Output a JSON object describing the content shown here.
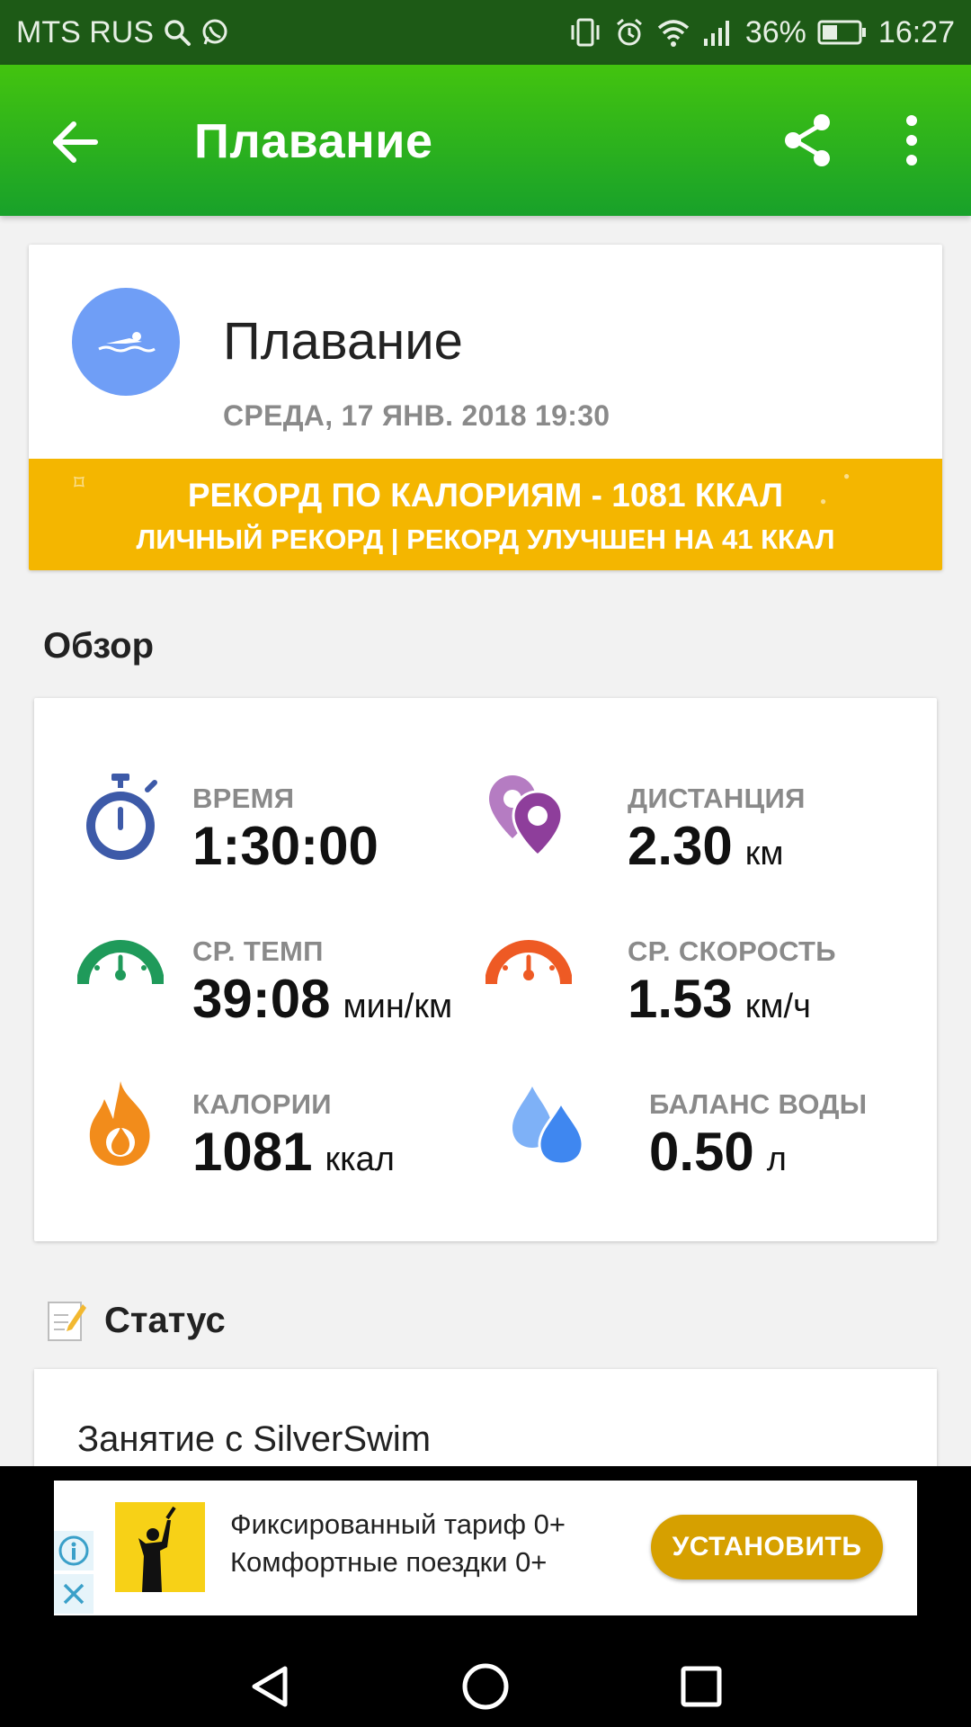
{
  "status_bar": {
    "carrier": "MTS RUS",
    "battery_percent": "36%",
    "time": "16:27",
    "icons": [
      "search-icon",
      "whatsapp-icon",
      "vibrate-icon",
      "alarm-icon",
      "wifi-icon",
      "signal-icon",
      "battery-icon"
    ]
  },
  "app_bar": {
    "title": "Плавание",
    "icons": [
      "back-arrow-icon",
      "share-icon",
      "more-vert-icon"
    ]
  },
  "activity": {
    "title": "Плавание",
    "date": "СРЕДА, 17 ЯНВ. 2018 19:30",
    "icon": "swimmer-icon",
    "avatar_color": "#6f9ef6"
  },
  "record": {
    "line1": "РЕКОРД ПО КАЛОРИЯМ  -  1081 ККАЛ",
    "line2": "ЛИЧНЫЙ РЕКОРД  |  РЕКОРД УЛУЧШЕН НА 41 ККАЛ",
    "color": "#f4b600"
  },
  "overview": {
    "title": "Обзор",
    "metrics": [
      {
        "label": "ВРЕМЯ",
        "value": "1:30:00",
        "unit": "",
        "icon": "stopwatch-icon",
        "color": "#3d5aa8"
      },
      {
        "label": "ДИСТАНЦИЯ",
        "value": "2.30",
        "unit": "км",
        "icon": "location-pins-icon",
        "color": "#8e3e9b"
      },
      {
        "label": "СР. ТЕМП",
        "value": "39:08",
        "unit": "мин/км",
        "icon": "gauge-green-icon",
        "color": "#1f9a5a"
      },
      {
        "label": "СР. СКОРОСТЬ",
        "value": "1.53",
        "unit": "км/ч",
        "icon": "gauge-orange-icon",
        "color": "#ee5a24"
      },
      {
        "label": "КАЛОРИИ",
        "value": "1081",
        "unit": "ккал",
        "icon": "flame-icon",
        "color": "#f28c1b"
      },
      {
        "label": "БАЛАНС ВОДЫ",
        "value": "0.50",
        "unit": "л",
        "icon": "water-drops-icon",
        "color": "#3f87f0"
      }
    ]
  },
  "status_section": {
    "title": "Статус",
    "icon": "note-edit-icon",
    "text": "Занятие с SilverSwim"
  },
  "ad": {
    "line1": "Фиксированный тариф 0+",
    "line2": "Комфортные поездки 0+",
    "cta": "УСТАНОВИТЬ",
    "icons": [
      "info-icon",
      "close-icon",
      "ad-logo-icon"
    ]
  },
  "nav_bar": {
    "icons": [
      "nav-back-icon",
      "nav-home-icon",
      "nav-recents-icon"
    ]
  }
}
